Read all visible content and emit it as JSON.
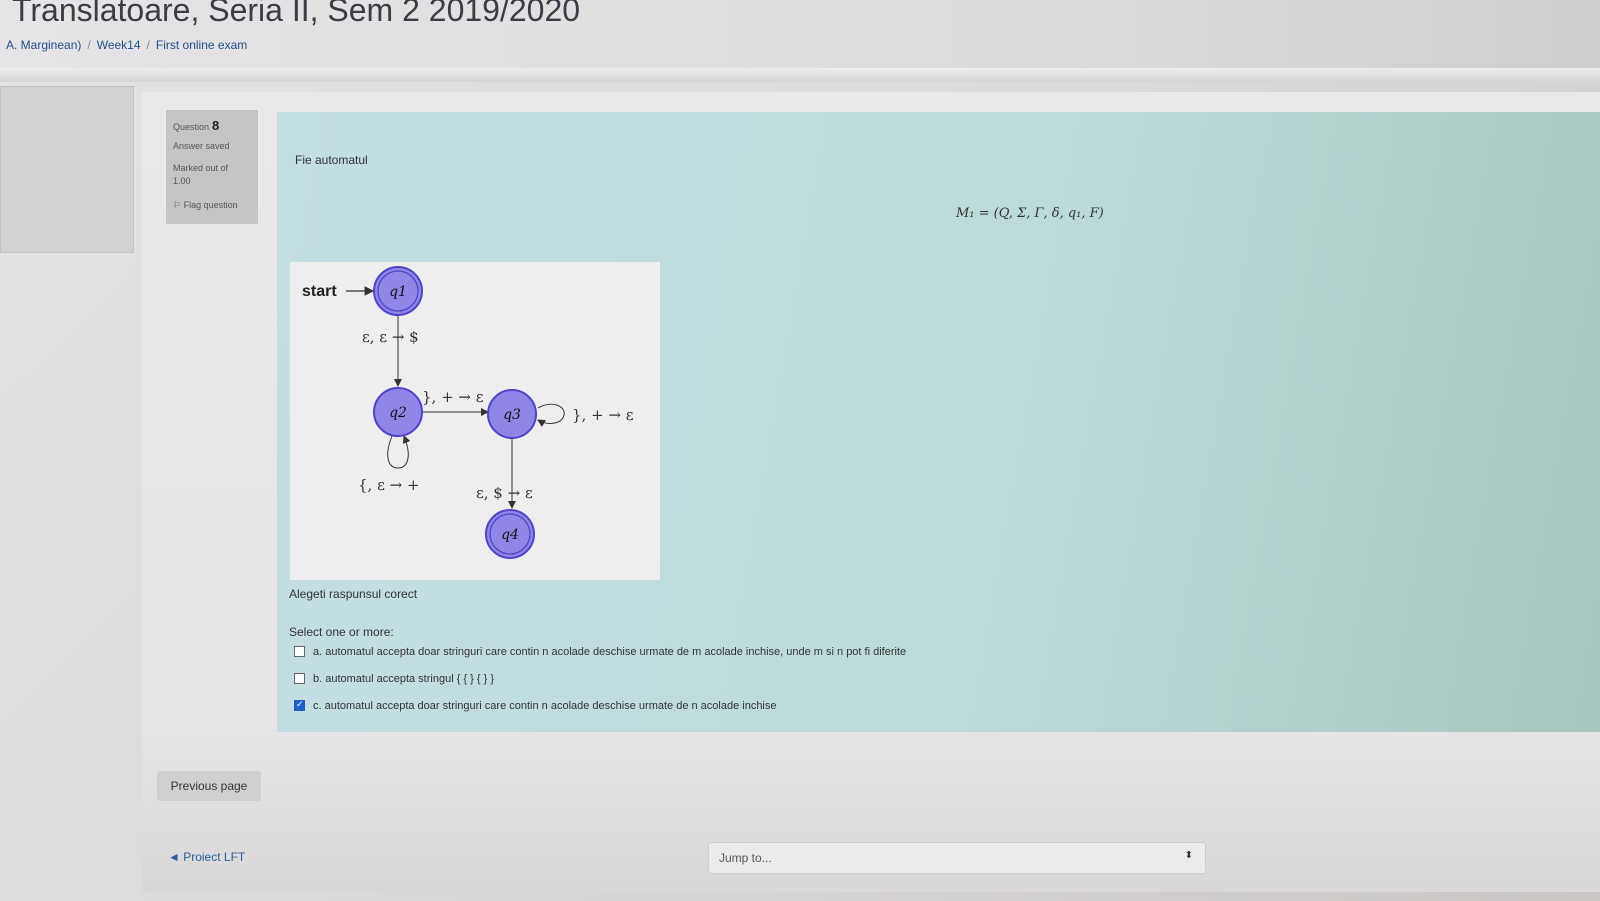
{
  "page": {
    "title": "Translatoare, Seria II, Sem 2 2019/2020",
    "breadcrumb": [
      "A. Marginean)",
      "Week14",
      "First online exam"
    ]
  },
  "question": {
    "label": "Question",
    "number": "8",
    "status": "Answer saved",
    "marked_line1": "Marked out of",
    "marked_line2": "1.00",
    "flag_label": "Flag question"
  },
  "formulation": {
    "intro": "Fie automatul",
    "formula": "M₁ = (Q, Σ, Γ, δ, q₁, F)",
    "instruction": "Alegeti raspunsul corect",
    "prompt": "Select one or more:"
  },
  "diagram": {
    "start_label": "start",
    "states": [
      "q1",
      "q2",
      "q3",
      "q4"
    ],
    "transitions": {
      "q1_q2": "ε, ε → $",
      "q2_q3": "}, + → ε",
      "q3_loop": "}, + → ε",
      "q2_loop": "{, ε → +",
      "q3_q4": "ε, $ → ε"
    },
    "colors": {
      "state_fill": "#8f86e8",
      "state_stroke": "#4d45c9"
    }
  },
  "options": [
    {
      "text": "a. automatul accepta doar stringuri care contin n acolade deschise urmate de m acolade inchise, unde m si n pot fi diferite",
      "checked": false
    },
    {
      "text": "b. automatul accepta stringul { { } { } }",
      "checked": false
    },
    {
      "text": "c. automatul accepta doar stringuri care contin n acolade deschise urmate de n acolade inchise",
      "checked": true
    }
  ],
  "navigation": {
    "previous_label": "Previous page",
    "link_label": "◄ Proiect LFT",
    "jump_label": "Jump to..."
  }
}
